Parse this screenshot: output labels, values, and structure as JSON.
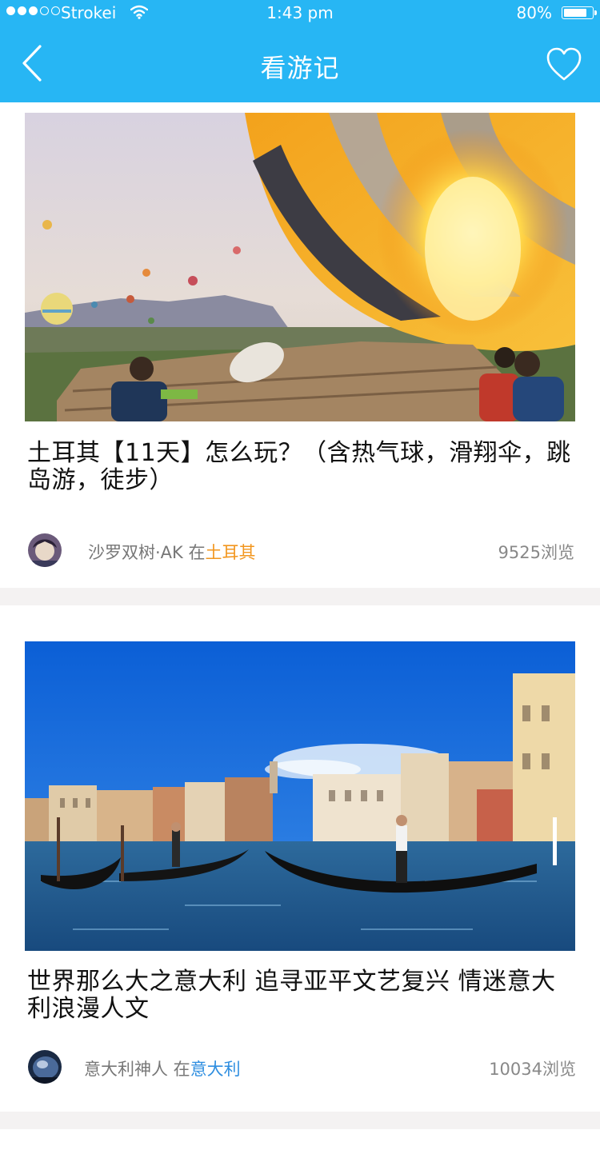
{
  "status_bar": {
    "carrier": "Strokei",
    "time": "1:43 pm",
    "battery": "80%"
  },
  "header": {
    "title": "看游记"
  },
  "posts": [
    {
      "title": "土耳其【11天】怎么玩？（含热气球，滑翔伞，跳岛游，徒步）",
      "author": "沙罗双树·AK",
      "in_text": " 在",
      "location": "土耳其",
      "views": "9525浏览"
    },
    {
      "title": "世界那么大之意大利 追寻亚平文艺复兴 情迷意大利浪漫人文",
      "author": "意大利神人",
      "in_text": " 在",
      "location": "意大利",
      "views": "10034浏览"
    }
  ],
  "colors": {
    "header": "#27b6f4",
    "location_1": "#f2961e",
    "location_2": "#2e8ee0"
  },
  "icons": {
    "back": "chevron-left-icon",
    "favorite": "heart-outline-icon",
    "wifi": "wifi-icon",
    "battery": "battery-icon"
  }
}
